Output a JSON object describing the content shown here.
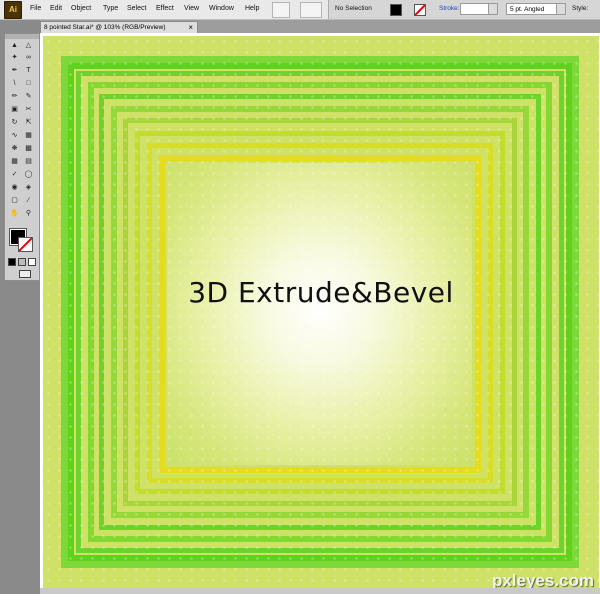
{
  "app": {
    "logo": "Ai",
    "menu": [
      "File",
      "Edit",
      "Object",
      "Type",
      "Select",
      "Effect",
      "View",
      "Window",
      "Help"
    ]
  },
  "control_bar": {
    "selection": "No Selection",
    "stroke_label": "Stroke:",
    "brush": "5 pt. Angled",
    "style_label": "Style:"
  },
  "document": {
    "tab_title": "8 pointed Star.ai* @ 103% (RGB/Preview)",
    "close_glyph": "×"
  },
  "artwork": {
    "headline": "3D Extrude&Bevel",
    "colors": {
      "outer": "#7fd83a",
      "bright_green": "#5fd21e",
      "mid": "#a8d63a",
      "yellow": "#e6dc1e",
      "center": "#ffffff"
    }
  },
  "watermark": "pxleyes.com"
}
